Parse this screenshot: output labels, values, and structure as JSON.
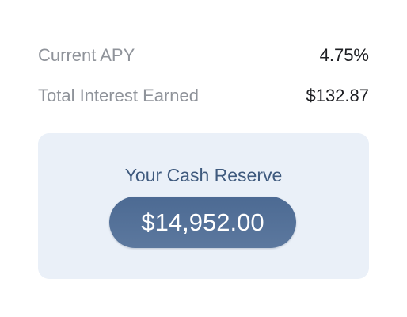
{
  "stats": {
    "apy_label": "Current APY",
    "apy_value": "4.75%",
    "interest_label": "Total Interest Earned",
    "interest_value": "$132.87"
  },
  "reserve": {
    "title": "Your Cash Reserve",
    "amount": "$14,952.00"
  },
  "colors": {
    "card_background": "#eaf0f8",
    "amount_pill": "#4f6d95",
    "title_text": "#3f5a7e",
    "label_text": "#8f939a"
  }
}
